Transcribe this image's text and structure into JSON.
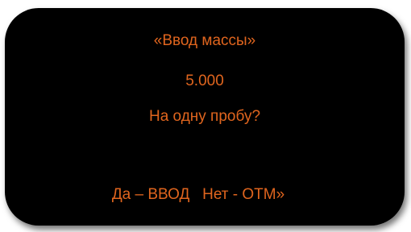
{
  "dialog": {
    "title": "«Ввод массы»",
    "value": "5.000",
    "question": "На одну пробу?",
    "softkeys": "Да – ВВОД   Нет - ОТМ»"
  },
  "colors": {
    "screen_background": "#000000",
    "text": "#e0651e"
  }
}
